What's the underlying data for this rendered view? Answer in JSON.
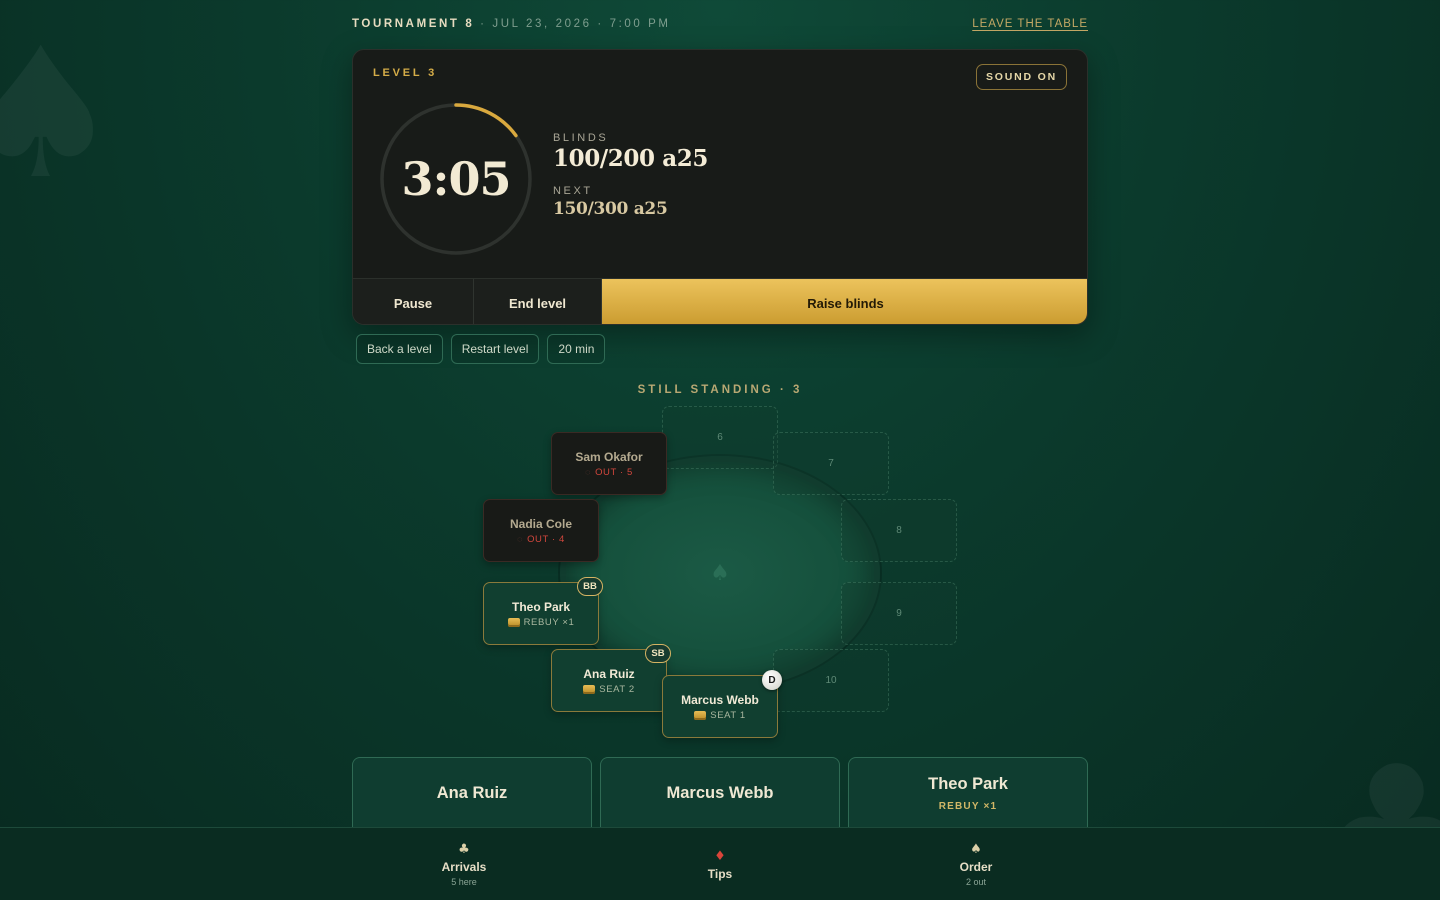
{
  "header": {
    "tournament": "TOURNAMENT 8",
    "datetime": "· JUL 23, 2026 · 7:00 PM",
    "leave_label": "LEAVE THE TABLE"
  },
  "timer": {
    "level_label": "LEVEL 3",
    "sound_label": "SOUND ON",
    "clock": "3:05",
    "progress_remaining": 0.15,
    "blinds_label": "BLINDS",
    "blinds_value": "100/200 a25",
    "next_label": "NEXT",
    "next_value": "150/300 a25",
    "pause_label": "Pause",
    "end_label": "End level",
    "raise_label": "Raise blinds"
  },
  "sub_controls": {
    "back_label": "Back a level",
    "restart_label": "Restart level",
    "duration_label": "20 min"
  },
  "standing_label": "STILL STANDING · 3",
  "seats": {
    "s1": {
      "name": "Marcus Webb",
      "sub": "SEAT 1"
    },
    "s2": {
      "name": "Ana Ruiz",
      "sub": "SEAT 2"
    },
    "s3": {
      "name": "Theo Park",
      "sub": "REBUY ×1"
    },
    "s4": {
      "name": "Nadia Cole",
      "sub": "OUT · 4"
    },
    "s5": {
      "name": "Sam Okafor",
      "sub": "OUT · 5"
    },
    "s6": "6",
    "s7": "7",
    "s8": "8",
    "s9": "9",
    "s10": "10"
  },
  "badges": {
    "bb": "BB",
    "sb": "SB",
    "dealer": "D"
  },
  "player_cards": [
    {
      "name": "Ana Ruiz",
      "sub": ""
    },
    {
      "name": "Marcus Webb",
      "sub": ""
    },
    {
      "name": "Theo Park",
      "sub": "REBUY ×1"
    }
  ],
  "nav": {
    "arrivals": {
      "icon": "club-icon",
      "label": "Arrivals",
      "sub": "5 here"
    },
    "tips": {
      "icon": "diamond-icon",
      "label": "Tips"
    },
    "order": {
      "icon": "spade-icon",
      "label": "Order",
      "sub": "2 out"
    }
  },
  "colors": {
    "accent_gold": "#d5ad48",
    "out_red": "#d0463c",
    "felt": "#15503c"
  }
}
